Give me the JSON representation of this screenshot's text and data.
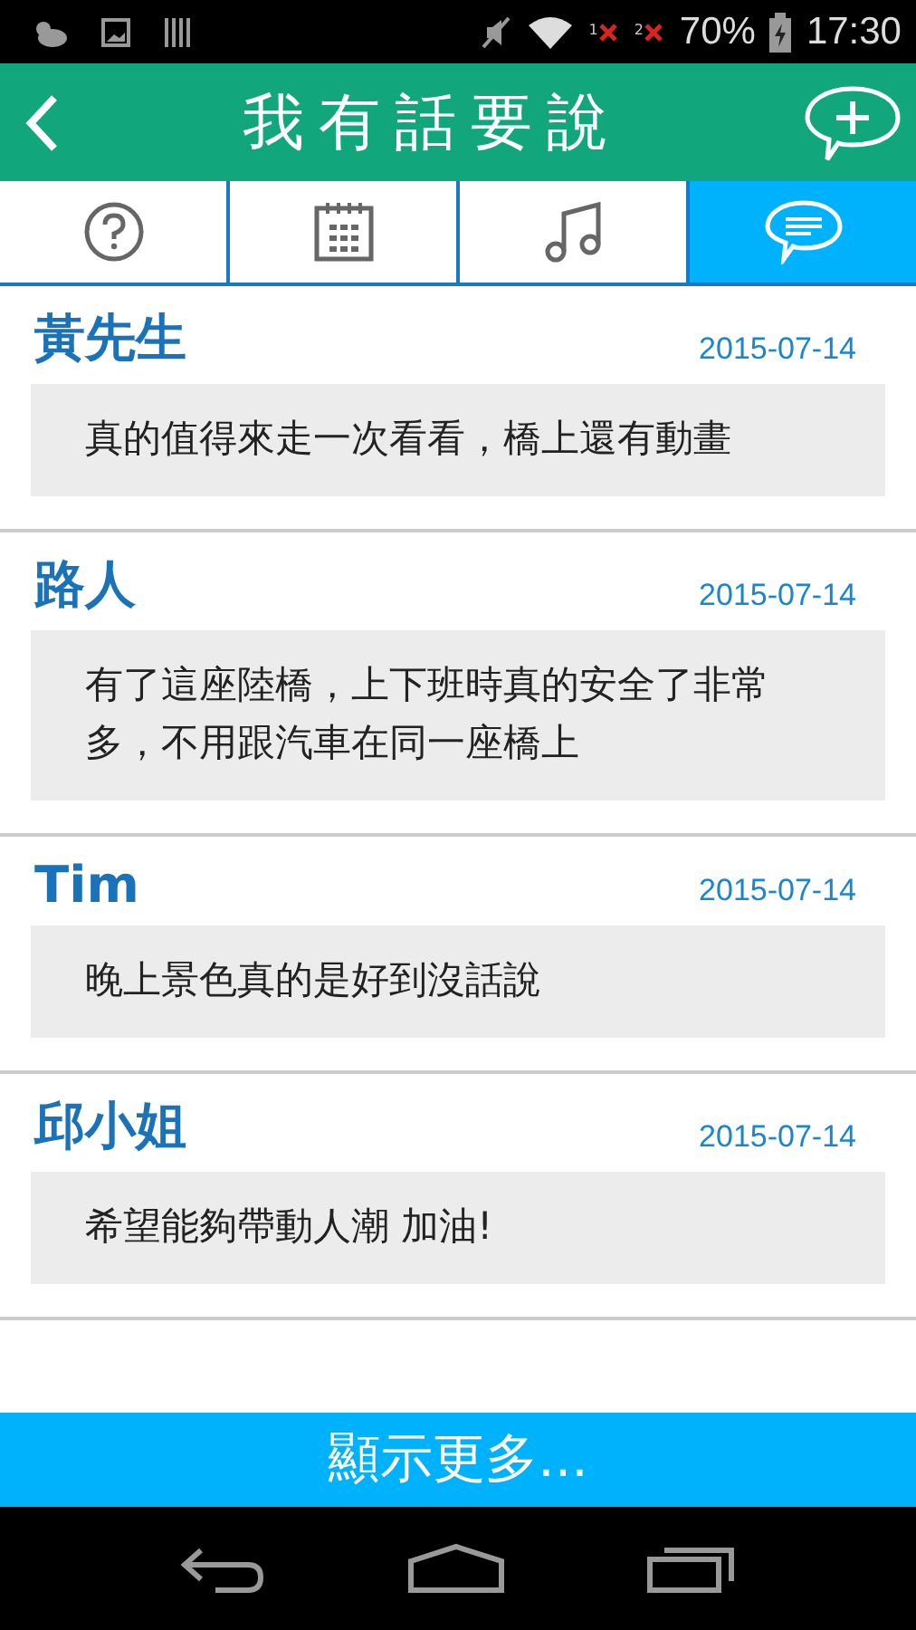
{
  "status_bar": {
    "sim_slots": [
      "1",
      "2"
    ],
    "battery": "70%",
    "time": "17:30"
  },
  "header": {
    "title": "我有話要說"
  },
  "tabs": [
    {
      "kind": "help",
      "selected": false
    },
    {
      "kind": "calendar",
      "selected": false
    },
    {
      "kind": "music",
      "selected": false
    },
    {
      "kind": "chat",
      "selected": true
    }
  ],
  "comments": [
    {
      "name": "黃先生",
      "date": "2015-07-14",
      "text": "真的值得來走一次看看，橋上還有動畫"
    },
    {
      "name": "路人",
      "date": "2015-07-14",
      "text": "有了這座陸橋，上下班時真的安全了非常多，不用跟汽車在同一座橋上"
    },
    {
      "name": "Tim",
      "date": "2015-07-14",
      "text": "晚上景色真的是好到沒話說"
    },
    {
      "name": "邱小姐",
      "date": "2015-07-14",
      "text": "希望能夠帶動人潮 加油!"
    }
  ],
  "more_button": "顯示更多..."
}
